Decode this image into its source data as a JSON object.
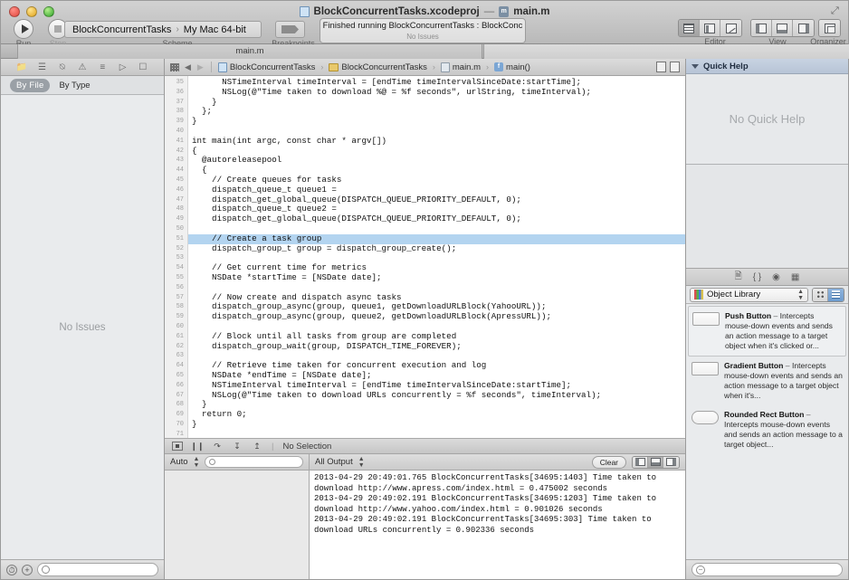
{
  "window": {
    "title": "BlockConcurrentTasks.xcodeproj",
    "title_separator": "—",
    "title_file": "main.m"
  },
  "toolbar": {
    "run_label": "Run",
    "stop_label": "Stop",
    "scheme_label": "Scheme",
    "breakpoints_label": "Breakpoints",
    "scheme_project": "BlockConcurrentTasks",
    "scheme_separator": "›",
    "scheme_destination": "My Mac 64-bit",
    "activity_primary": "Finished running BlockConcurrentTasks : BlockConc",
    "activity_secondary": "No Issues",
    "editor_label": "Editor",
    "view_label": "View",
    "organizer_label": "Organizer"
  },
  "tabbar": {
    "active_tab": "main.m"
  },
  "navigator": {
    "icons": [
      "folder-icon",
      "git-icon",
      "clock-icon",
      "warning-icon",
      "lines-icon",
      "breakpoint-icon",
      "log-icon"
    ],
    "filter_by_file": "By File",
    "filter_by_type": "By Type",
    "empty_state": "No Issues"
  },
  "jumpbar": {
    "back_arrow": "◀",
    "forward_arrow": "▶",
    "crumbs": [
      {
        "label": "BlockConcurrentTasks",
        "icon": "project-icon"
      },
      {
        "label": "BlockConcurrentTasks",
        "icon": "folder-icon"
      },
      {
        "label": "main.m",
        "icon": "source-file-icon"
      },
      {
        "label": "main()",
        "icon": "function-icon"
      }
    ],
    "separator": "›"
  },
  "editor": {
    "first_line_number": 35,
    "highlighted_line": 51,
    "lines": [
      "      NSTimeInterval timeInterval = [endTime timeIntervalSinceDate:startTime];",
      "      NSLog(@\"Time taken to download %@ = %f seconds\", urlString, timeInterval);",
      "    }",
      "  };",
      "}",
      "",
      "int main(int argc, const char * argv[])",
      "{",
      "  @autoreleasepool",
      "  {",
      "    // Create queues for tasks",
      "    dispatch_queue_t queue1 =",
      "    dispatch_get_global_queue(DISPATCH_QUEUE_PRIORITY_DEFAULT, 0);",
      "    dispatch_queue_t queue2 =",
      "    dispatch_get_global_queue(DISPATCH_QUEUE_PRIORITY_DEFAULT, 0);",
      "",
      "    // Create a task group",
      "    dispatch_group_t group = dispatch_group_create();",
      "",
      "    // Get current time for metrics",
      "    NSDate *startTime = [NSDate date];",
      "",
      "    // Now create and dispatch async tasks",
      "    dispatch_group_async(group, queue1, getDownloadURLBlock(YahooURL));",
      "    dispatch_group_async(group, queue2, getDownloadURLBlock(ApressURL));",
      "",
      "    // Block until all tasks from group are completed",
      "    dispatch_group_wait(group, DISPATCH_TIME_FOREVER);",
      "",
      "    // Retrieve time taken for concurrent execution and log",
      "    NSDate *endTime = [NSDate date];",
      "    NSTimeInterval timeInterval = [endTime timeIntervalSinceDate:startTime];",
      "    NSLog(@\"Time taken to download URLs concurrently = %f seconds\", timeInterval);",
      "  }",
      "  return 0;",
      "}",
      "",
      ""
    ]
  },
  "debugbar": {
    "selection_label": "No Selection",
    "separator": "|"
  },
  "variables_pane": {
    "scope_label": "Auto",
    "search_placeholder": ""
  },
  "console": {
    "filter_label": "All Output",
    "clear_label": "Clear",
    "output": "2013-04-29 20:49:01.765 BlockConcurrentTasks[34695:1403] Time taken to\ndownload http://www.apress.com/index.html = 0.475002 seconds\n2013-04-29 20:49:02.191 BlockConcurrentTasks[34695:1203] Time taken to\ndownload http://www.yahoo.com/index.html = 0.901026 seconds\n2013-04-29 20:49:02.191 BlockConcurrentTasks[34695:303] Time taken to\ndownload URLs concurrently = 0.902336 seconds"
  },
  "utilities": {
    "quick_help_title": "Quick Help",
    "quick_help_empty": "No Quick Help",
    "library_selector": "Object Library",
    "library_items": [
      {
        "name": "Push Button",
        "dash": " – ",
        "description": "Intercepts mouse-down events and sends an action message to a target object when it's clicked or...",
        "shape": "rect"
      },
      {
        "name": "Gradient Button",
        "dash": " – ",
        "description": "Intercepts mouse-down events and sends an action message to a target object when it's...",
        "shape": "rect"
      },
      {
        "name": "Rounded Rect Button",
        "dash": " – ",
        "description": "Intercepts mouse-down events and sends an action message to a target object...",
        "shape": "round"
      }
    ],
    "search_placeholder": ""
  },
  "colors": {
    "highlight": "#b3d4f0",
    "quick_help_header": "#c8d3e2",
    "accent": "#6d9bcd"
  }
}
